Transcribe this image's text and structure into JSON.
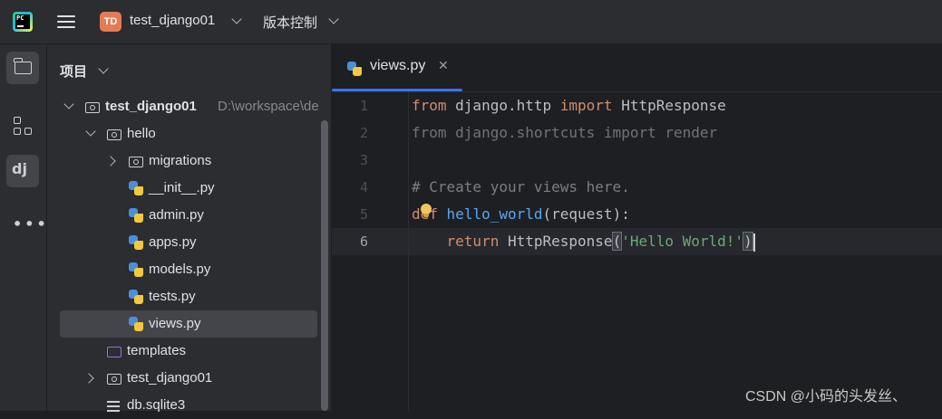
{
  "titlebar": {
    "app_icon": "pycharm-logo",
    "project_badge": "TD",
    "project_name": "test_django01",
    "vcs_label": "版本控制"
  },
  "toolstrip": {
    "items": [
      "project-folder-icon",
      "structure-icon",
      "django-icon",
      "more-icon"
    ]
  },
  "project_panel": {
    "title": "项目",
    "tree": [
      {
        "label": "test_django01",
        "path": "D:\\workspace\\de",
        "type": "project-root",
        "expanded": true
      },
      {
        "label": "hello",
        "type": "package",
        "expanded": true
      },
      {
        "label": "migrations",
        "type": "package",
        "expanded": false
      },
      {
        "label": "__init__.py",
        "type": "python-file"
      },
      {
        "label": "admin.py",
        "type": "python-file"
      },
      {
        "label": "apps.py",
        "type": "python-file"
      },
      {
        "label": "models.py",
        "type": "python-file"
      },
      {
        "label": "tests.py",
        "type": "python-file"
      },
      {
        "label": "views.py",
        "type": "python-file",
        "selected": true
      },
      {
        "label": "templates",
        "type": "templates-folder"
      },
      {
        "label": "test_django01",
        "type": "package",
        "expanded": false
      },
      {
        "label": "db.sqlite3",
        "type": "database-file"
      }
    ]
  },
  "editor": {
    "tab": {
      "label": "views.py",
      "close": "✕"
    },
    "line_numbers": [
      "1",
      "2",
      "3",
      "4",
      "5",
      "6"
    ],
    "current_line": 6,
    "code": {
      "l1": {
        "kw1": "from",
        "mod": " django.http ",
        "kw2": "import",
        "name": " HttpResponse"
      },
      "l2": "from django.shortcuts import render",
      "l4": "# Create your views here.",
      "l5": {
        "kw": "def",
        "fn": "hello_world",
        "rest": "(request):"
      },
      "l6": {
        "indent": "    ",
        "kw": "return",
        "call": " HttpResponse",
        "open": "(",
        "str": "'Hello World!'",
        "close": ")"
      }
    }
  },
  "watermark": "CSDN @小码的头发丝、",
  "colors": {
    "accent": "#3574f0",
    "keyword": "#cf8e6d",
    "function": "#56a8f5",
    "string": "#6aab73",
    "comment": "#7a7e85"
  }
}
